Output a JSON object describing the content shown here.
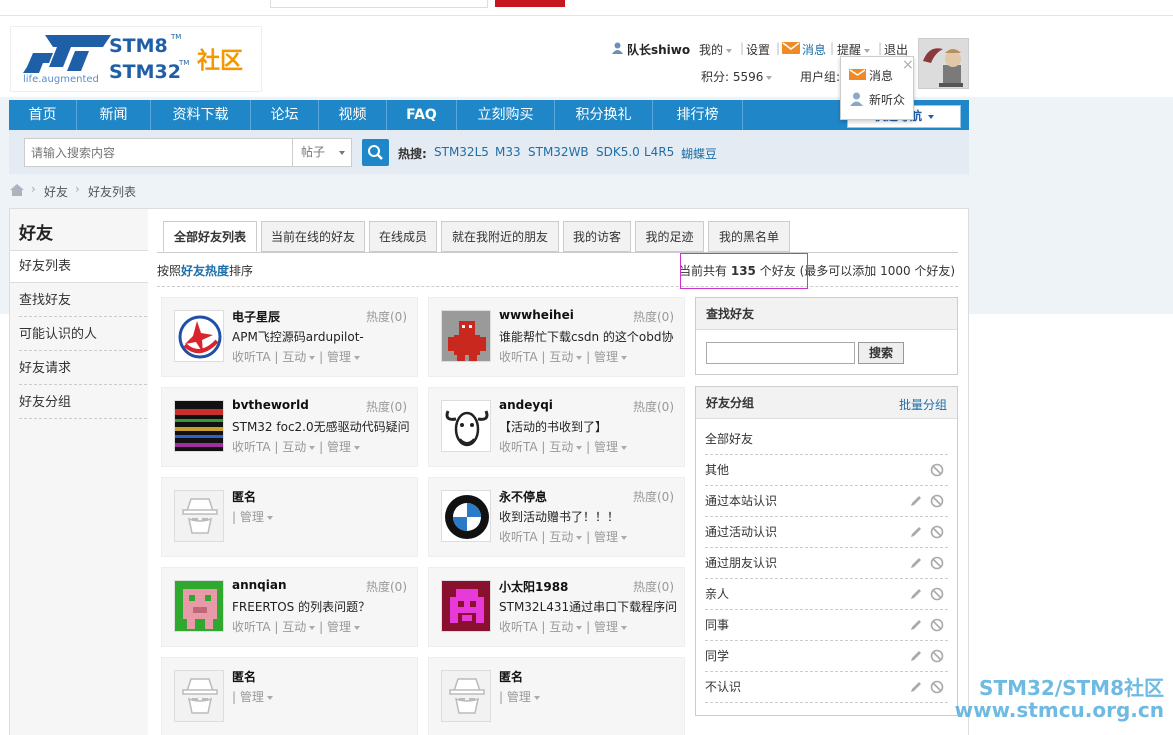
{
  "header": {
    "logo_brand_1": "STM8",
    "logo_brand_2": "STM32",
    "logo_tm": "TM",
    "logo_community": "社区",
    "logo_tagline": "life.augmented",
    "username": "队长shiwo",
    "my": "我的",
    "settings": "设置",
    "messages": "消息",
    "reminders": "提醒",
    "logout": "退出",
    "points": "积分: 5596",
    "usergroup": "用户组:"
  },
  "popup": {
    "messages": "消息",
    "new_listener": "新听众",
    "close": "×"
  },
  "nav": {
    "items": [
      "首页",
      "新闻",
      "资料下载",
      "论坛",
      "视频",
      "FAQ",
      "立刻购买",
      "积分换礼",
      "排行榜"
    ],
    "quick_nav": "快速导航"
  },
  "search": {
    "placeholder": "请输入搜索内容",
    "scope": "帖子",
    "hot_label": "热搜:",
    "hot": [
      "STM32L5",
      "M33",
      "STM32WB",
      "SDK5.0",
      "L4R5",
      "蝴蝶豆"
    ]
  },
  "breadcrumb": [
    "好友",
    "好友列表"
  ],
  "sidebar": {
    "title": "好友",
    "items": [
      "好友列表",
      "查找好友",
      "可能认识的人",
      "好友请求",
      "好友分组"
    ]
  },
  "tabs": [
    "全部好友列表",
    "当前在线的好友",
    "在线成员",
    "就在我附近的朋友",
    "我的访客",
    "我的足迹",
    "我的黑名单"
  ],
  "sortbar": {
    "prefix": "按照",
    "key": "好友热度",
    "suffix": "排序",
    "count_prefix": "当前共有",
    "count": "135",
    "count_suffix": "个好友",
    "limit": "(最多可以添加 1000 个好友)"
  },
  "friends": [
    {
      "name": "电子星辰",
      "heat": "热度(0)",
      "status": "APM飞控源码ardupilot-",
      "follow": "收听TA",
      "interact": "互动",
      "manage": "管理",
      "avatar_icon": "star-logo-icon"
    },
    {
      "name": "wwwheihei",
      "heat": "热度(0)",
      "status": "谁能帮忙下载csdn 的这个obd协",
      "follow": "收听TA",
      "interact": "互动",
      "manage": "管理",
      "avatar_icon": "robot-icon"
    },
    {
      "name": "bvtheworld",
      "heat": "热度(0)",
      "status": "STM32 foc2.0无感驱动代码疑问",
      "follow": "收听TA",
      "interact": "互动",
      "manage": "管理",
      "avatar_icon": "spectrum-icon"
    },
    {
      "name": "andeyqi",
      "heat": "热度(0)",
      "status": "【活动的书收到了】",
      "follow": "收听TA",
      "interact": "互动",
      "manage": "管理",
      "avatar_icon": "gnu-icon"
    },
    {
      "name": "匿名",
      "heat": "",
      "status": "",
      "follow": "",
      "interact": "",
      "manage": "管理",
      "avatar_icon": "anonymous-icon"
    },
    {
      "name": "永不停息",
      "heat": "热度(0)",
      "status": "收到活动赠书了！！！",
      "follow": "收听TA",
      "interact": "互动",
      "manage": "管理",
      "avatar_icon": "bmw-icon"
    },
    {
      "name": "annqian",
      "heat": "热度(0)",
      "status": "FREERTOS 的列表问题？",
      "follow": "收听TA",
      "interact": "互动",
      "manage": "管理",
      "avatar_icon": "pixel-pig-icon"
    },
    {
      "name": "小太阳1988",
      "heat": "热度(0)",
      "status": "STM32L431通过串口下载程序问",
      "follow": "收听TA",
      "interact": "互动",
      "manage": "管理",
      "avatar_icon": "pixel-invader-icon"
    },
    {
      "name": "匿名",
      "heat": "",
      "status": "",
      "follow": "",
      "interact": "",
      "manage": "管理",
      "avatar_icon": "anonymous-icon"
    },
    {
      "name": "匿名",
      "heat": "",
      "status": "",
      "follow": "",
      "interact": "",
      "manage": "管理",
      "avatar_icon": "anonymous-icon"
    }
  ],
  "find_box": {
    "title": "查找好友",
    "button": "搜索"
  },
  "groups_box": {
    "title": "好友分组",
    "batch": "批量分组",
    "items": [
      "全部好友",
      "其他",
      "通过本站认识",
      "通过活动认识",
      "通过朋友认识",
      "亲人",
      "同事",
      "同学",
      "不认识"
    ]
  },
  "watermark": {
    "line1": "STM32/STM8社区",
    "line2": "www.stmcu.org.cn"
  },
  "colors": {
    "nav_blue": "#1f87c7",
    "link_blue": "#1d6fa8",
    "highlight_box": "#cc33cc"
  }
}
